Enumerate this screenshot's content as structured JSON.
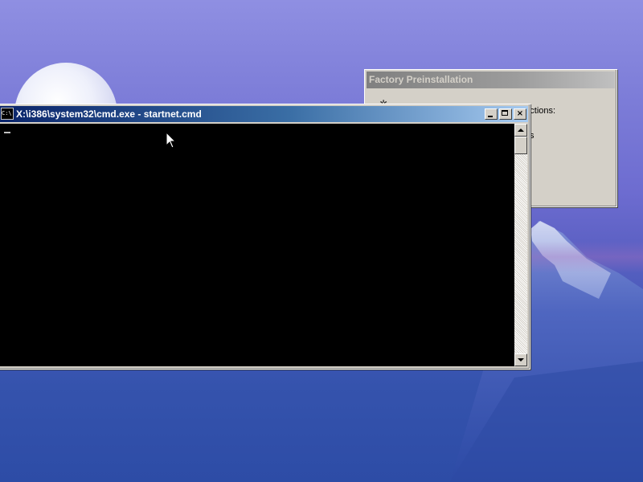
{
  "factory_dialog": {
    "title": "Factory Preinstallation",
    "partial_text_1": "g actions:",
    "partial_text_2": "s"
  },
  "cmd_window": {
    "title": "X:\\i386\\system32\\cmd.exe - startnet.cmd",
    "icon_label": "C:\\",
    "minimize_icon": "minimize-icon",
    "maximize_icon": "maximize-icon",
    "close_glyph": "×",
    "console_background": "#000000",
    "titlebar_color": "#0a246a"
  },
  "desktop": {
    "wallpaper_colors": [
      "#8f8fe2",
      "#2d4ca6"
    ]
  }
}
